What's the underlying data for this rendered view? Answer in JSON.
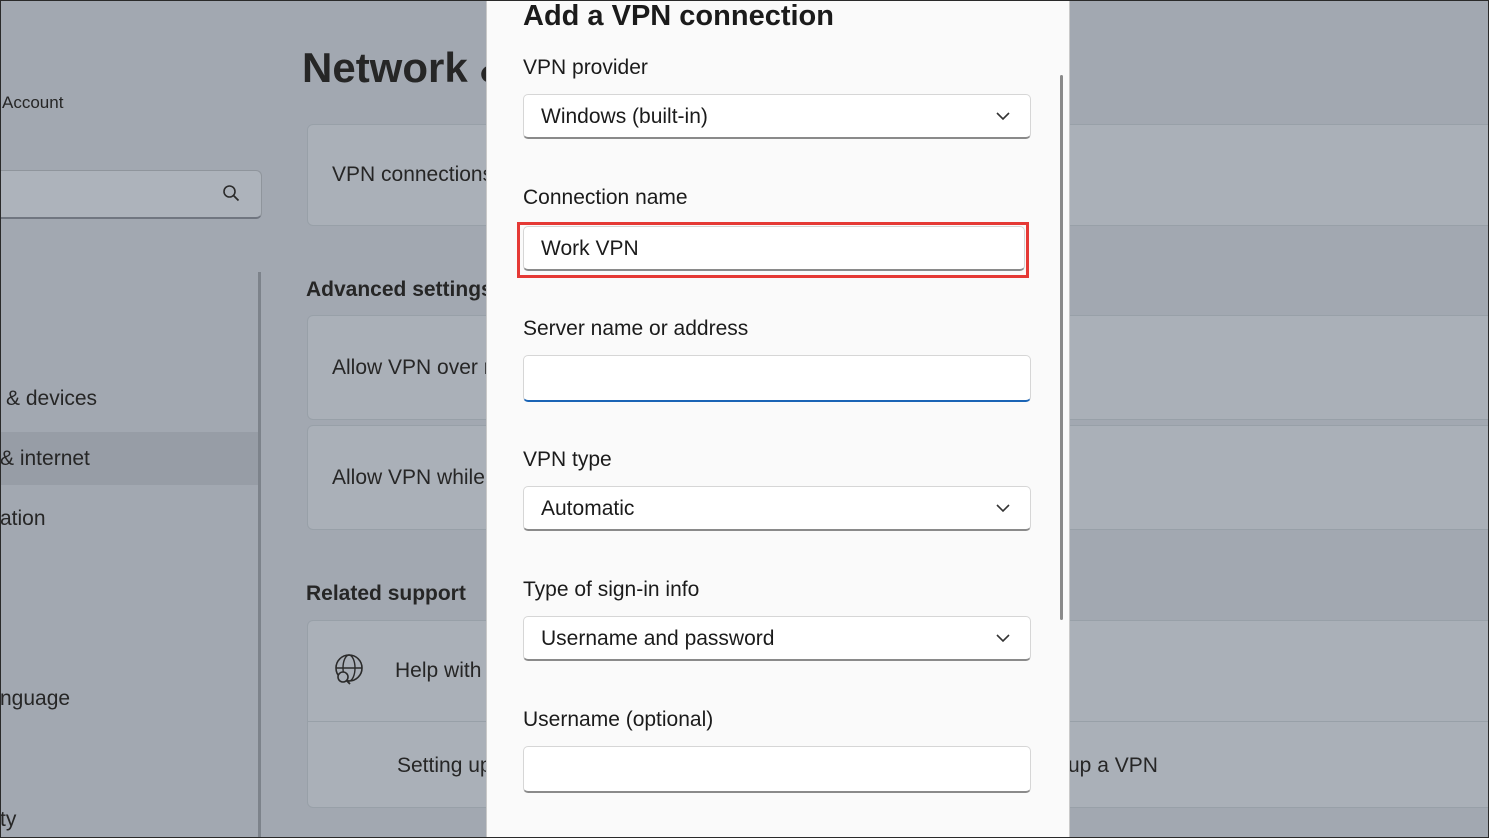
{
  "background": {
    "account_label": "Account",
    "search_placeholder": "",
    "page_title": "Network &",
    "vpn_connections_card": "VPN connections",
    "advanced_settings_header": "Advanced settings",
    "allow_vpn_metered": "Allow VPN over r",
    "allow_vpn_roaming": "Allow VPN while",
    "related_support_header": "Related support",
    "help_with": "Help with",
    "setting_up_link": "Setting up",
    "setting_up_link_right": "up a VPN",
    "nav_items": [
      "& devices",
      "& internet",
      "ation",
      "nguage",
      "ty"
    ]
  },
  "dialog": {
    "title": "Add a VPN connection",
    "vpn_provider_label": "VPN provider",
    "vpn_provider_value": "Windows (built-in)",
    "connection_name_label": "Connection name",
    "connection_name_value": "Work VPN",
    "server_label": "Server name or address",
    "server_value": "",
    "vpn_type_label": "VPN type",
    "vpn_type_value": "Automatic",
    "signin_type_label": "Type of sign-in info",
    "signin_type_value": "Username and password",
    "username_label": "Username (optional)",
    "username_value": ""
  },
  "colors": {
    "highlight_box": "#e53935",
    "focus_accent": "#1a64b5",
    "link": "#1d4f86"
  }
}
